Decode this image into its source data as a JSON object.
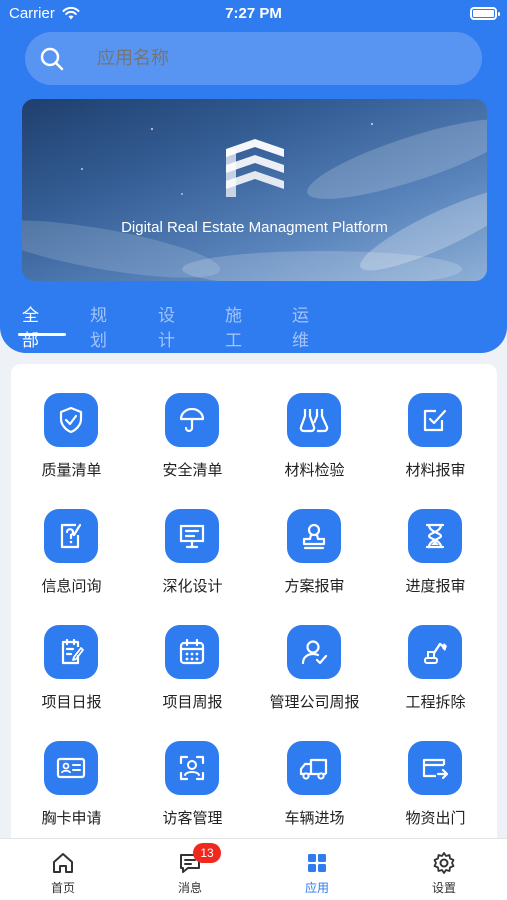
{
  "status_bar": {
    "carrier": "Carrier",
    "time": "7:27 PM"
  },
  "search": {
    "placeholder": "应用名称"
  },
  "banner": {
    "caption": "Digital Real Estate Managment Platform"
  },
  "tabs": [
    {
      "label": "全部",
      "active": true
    },
    {
      "label": "规划",
      "active": false
    },
    {
      "label": "设计",
      "active": false
    },
    {
      "label": "施工",
      "active": false
    },
    {
      "label": "运维",
      "active": false
    }
  ],
  "apps": [
    {
      "label": "质量清单",
      "icon": "shield-check-icon"
    },
    {
      "label": "安全清单",
      "icon": "umbrella-icon"
    },
    {
      "label": "材料检验",
      "icon": "flask-icon"
    },
    {
      "label": "材料报审",
      "icon": "checkbox-edit-icon"
    },
    {
      "label": "信息问询",
      "icon": "question-doc-icon"
    },
    {
      "label": "深化设计",
      "icon": "presentation-icon"
    },
    {
      "label": "方案报审",
      "icon": "stamp-icon"
    },
    {
      "label": "进度报审",
      "icon": "hourglass-icon"
    },
    {
      "label": "项目日报",
      "icon": "daily-report-icon"
    },
    {
      "label": "项目周报",
      "icon": "calendar-icon"
    },
    {
      "label": "管理公司周报",
      "icon": "user-check-icon"
    },
    {
      "label": "工程拆除",
      "icon": "excavator-icon"
    },
    {
      "label": "胸卡申请",
      "icon": "id-card-icon"
    },
    {
      "label": "访客管理",
      "icon": "face-scan-icon"
    },
    {
      "label": "车辆进场",
      "icon": "truck-icon"
    },
    {
      "label": "物资出门",
      "icon": "wallet-exit-icon"
    }
  ],
  "tabbar": [
    {
      "label": "首页",
      "icon": "home-icon",
      "active": false
    },
    {
      "label": "消息",
      "icon": "message-icon",
      "active": false,
      "badge": "13"
    },
    {
      "label": "应用",
      "icon": "apps-grid-icon",
      "active": true
    },
    {
      "label": "设置",
      "icon": "gear-icon",
      "active": false
    }
  ],
  "colors": {
    "primary": "#2f7bf0",
    "badge": "#f0281e",
    "background": "#eef1f6"
  }
}
